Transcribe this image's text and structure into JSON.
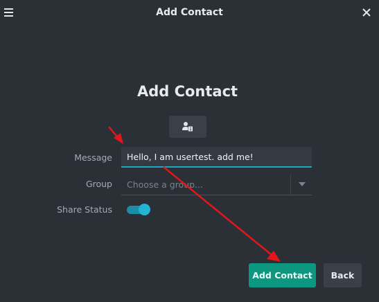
{
  "window": {
    "title": "Add Contact",
    "menu_icon": "hamburger-menu-icon",
    "close_icon": "close-icon"
  },
  "header": {
    "heading": "Add Contact",
    "avatar_icon": "contact-info-icon"
  },
  "form": {
    "message_label": "Message",
    "message_value": "Hello, I am usertest. add me!",
    "group_label": "Group",
    "group_placeholder": "Choose a group...",
    "share_status_label": "Share Status",
    "share_status_on": true
  },
  "buttons": {
    "add_contact": "Add Contact",
    "back": "Back"
  },
  "colors": {
    "background": "#2b3036",
    "accent": "#1ea7c4",
    "primary_button": "#0d9781",
    "annotation": "#e3161b"
  }
}
